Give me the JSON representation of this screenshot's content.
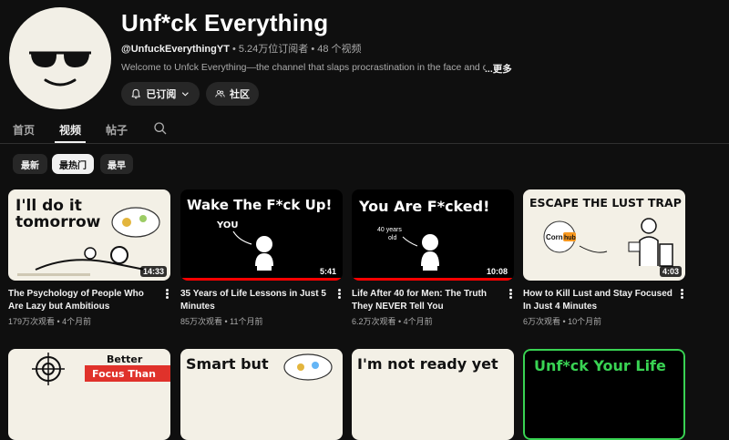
{
  "channel": {
    "title": "Unf*ck Everything",
    "handle": "@UnfuckEverythingYT",
    "stats": " • 5.24万位订阅者 • 48 个视频",
    "description": "Welcome to Unfck Everything—the channel that slaps procrastination in the face and drop",
    "more": "...更多",
    "subscribe_label": "已订阅",
    "community_label": "社区"
  },
  "tabs": [
    {
      "label": "首页"
    },
    {
      "label": "视频"
    },
    {
      "label": "帖子"
    }
  ],
  "chips": [
    {
      "label": "最新"
    },
    {
      "label": "最热门"
    },
    {
      "label": "最早"
    }
  ],
  "videos": [
    {
      "title": "The Psychology of People Who Are Lazy but Ambitious",
      "meta": "179万次观看 • 4个月前",
      "duration": "14:33",
      "thumb_text": [
        "I'll do it",
        "tomorrow"
      ],
      "progress": 0
    },
    {
      "title": "35 Years of Life Lessons in Just 5 Minutes",
      "meta": "85万次观看 • 11个月前",
      "duration": "5:41",
      "thumb_text": [
        "Wake The F*ck Up!",
        "YOU"
      ],
      "progress": 1.0
    },
    {
      "title": "Life After 40 for Men: The Truth They NEVER Tell You",
      "meta": "6.2万次观看 • 4个月前",
      "duration": "10:08",
      "thumb_text": [
        "You Are F*cked!",
        "40 years",
        "old"
      ],
      "progress": 1.0
    },
    {
      "title": "How to Kill Lust and Stay Focused In Just 4 Minutes",
      "meta": "6万次观看 • 10个月前",
      "duration": "4:03",
      "thumb_text": [
        "ESCAPE THE LUST TRAP",
        "Corn",
        "hub"
      ],
      "progress": 0
    }
  ],
  "next_row": [
    {
      "thumb_text": [
        "Better",
        "Focus Than"
      ]
    },
    {
      "thumb_text": [
        "Smart but"
      ]
    },
    {
      "thumb_text": [
        "I'm not ready yet"
      ]
    },
    {
      "thumb_text": [
        "Unf*ck Your Life"
      ]
    }
  ],
  "colors": {
    "background": "#0f0f0f",
    "chip": "#272727",
    "accent_green": "#39d353",
    "accent_red": "#ff0000",
    "lust_red": "#e0322b"
  }
}
